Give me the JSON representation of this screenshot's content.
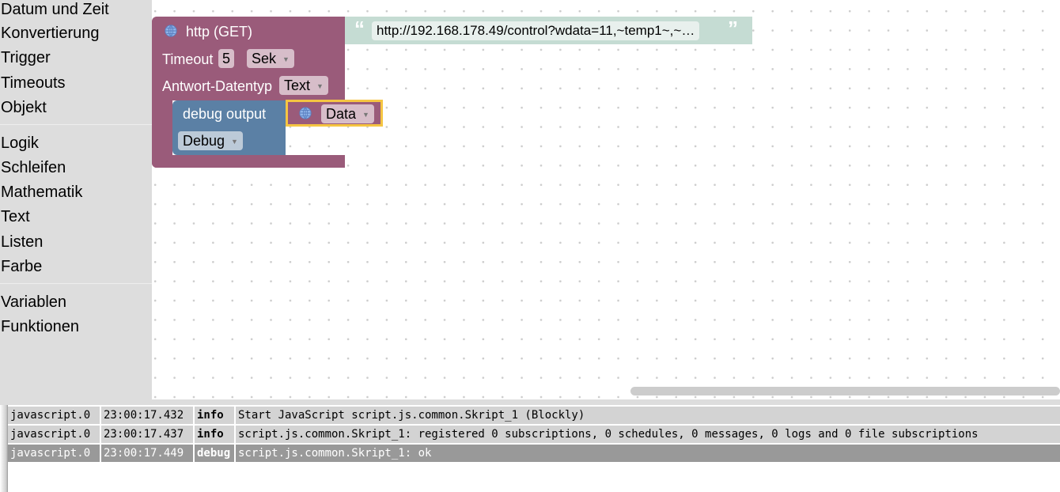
{
  "sidebar": {
    "groups": [
      [
        "Datum und Zeit",
        "Konvertierung",
        "Trigger",
        "Timeouts",
        "Objekt"
      ],
      [
        "Logik",
        "Schleifen",
        "Mathematik",
        "Text",
        "Listen",
        "Farbe"
      ],
      [
        "Variablen",
        "Funktionen"
      ]
    ]
  },
  "blocks": {
    "http": {
      "title": "http (GET)",
      "timeout_label": "Timeout",
      "timeout_value": "5",
      "unit": "Sek",
      "response_label": "Antwort-Datentyp",
      "response_type": "Text"
    },
    "url": {
      "open_quote": "“",
      "value": "http://192.168.178.49/control?wdata=11,~temp1~,~…",
      "close_quote": "”"
    },
    "debug": {
      "title": "debug output",
      "level": "Debug"
    },
    "data": {
      "label": "Data"
    }
  },
  "colors": {
    "http_block": "#9a5b7a",
    "debug_block": "#5b80a5",
    "text_block": "#c5dcd3",
    "selected_outline": "#f5c542"
  },
  "log": {
    "rows": [
      {
        "source": "javascript.0",
        "time": "23:00:17.432",
        "level": "info",
        "message": "Start JavaScript script.js.common.Skript_1 (Blockly)"
      },
      {
        "source": "javascript.0",
        "time": "23:00:17.437",
        "level": "info",
        "message": "script.js.common.Skript_1: registered 0 subscriptions, 0 schedules, 0 messages, 0 logs and 0 file subscriptions"
      },
      {
        "source": "javascript.0",
        "time": "23:00:17.449",
        "level": "debug",
        "message": "script.js.common.Skript_1: ok"
      }
    ]
  }
}
